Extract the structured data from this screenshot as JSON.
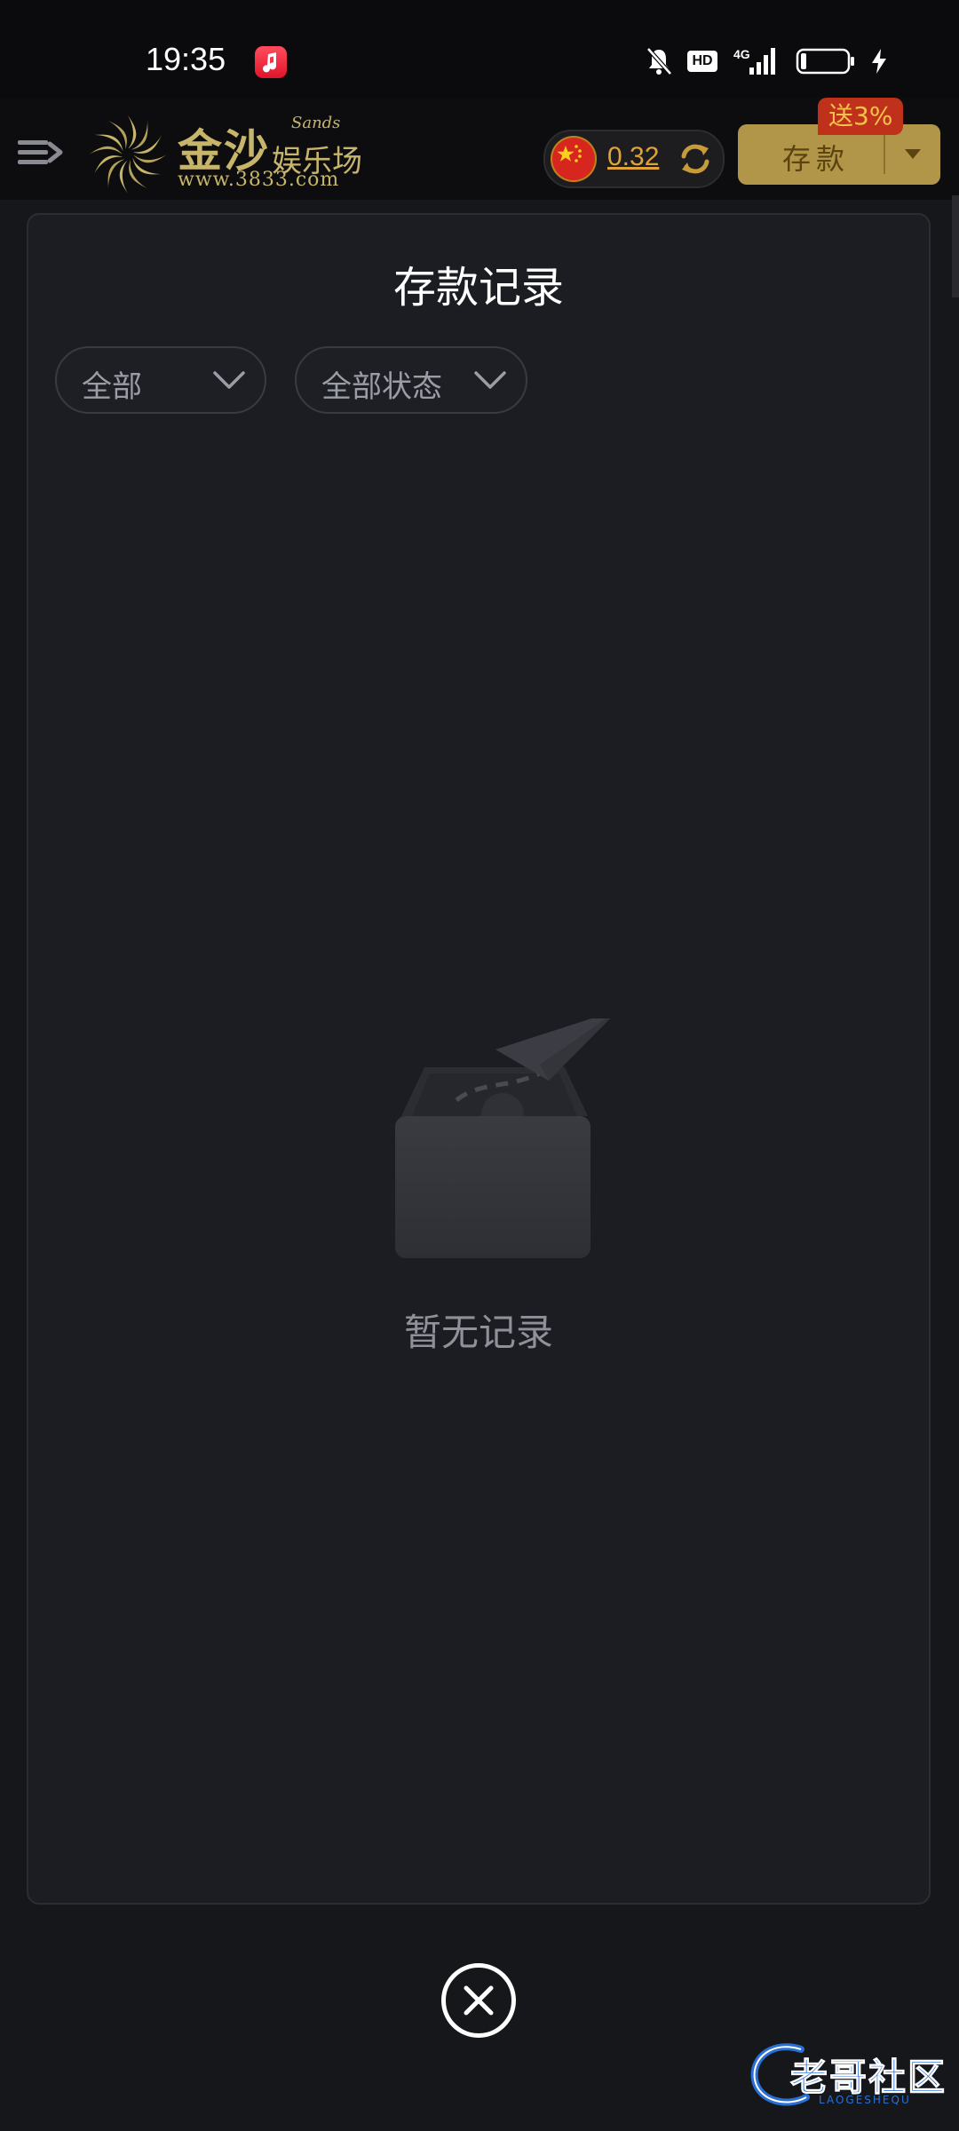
{
  "status_bar": {
    "time": "19:35",
    "hd_label": "HD",
    "network_label": "4G",
    "icons": [
      "music-app-icon",
      "bell-off-icon",
      "hd-icon",
      "signal-icon",
      "battery-icon",
      "charging-bolt-icon"
    ]
  },
  "header": {
    "logo": {
      "name_cn": "金沙",
      "subtitle_cn": "娱乐场",
      "name_en": "Sands",
      "url": "www.3833.com"
    },
    "balance": "0.32",
    "deposit_label": "存款",
    "promo_badge": "送3%"
  },
  "modal": {
    "title": "存款记录",
    "filters": [
      {
        "label": "全部"
      },
      {
        "label": "全部状态"
      }
    ],
    "empty_text": "暂无记录"
  },
  "watermark": {
    "text": "老哥社区",
    "sub": "LAOGESHEQU"
  },
  "colors": {
    "background": "#16171b",
    "modal_bg": "#1c1d22",
    "gold": "#b19548",
    "balance": "#e0a33a",
    "promo": "#c0311c"
  }
}
